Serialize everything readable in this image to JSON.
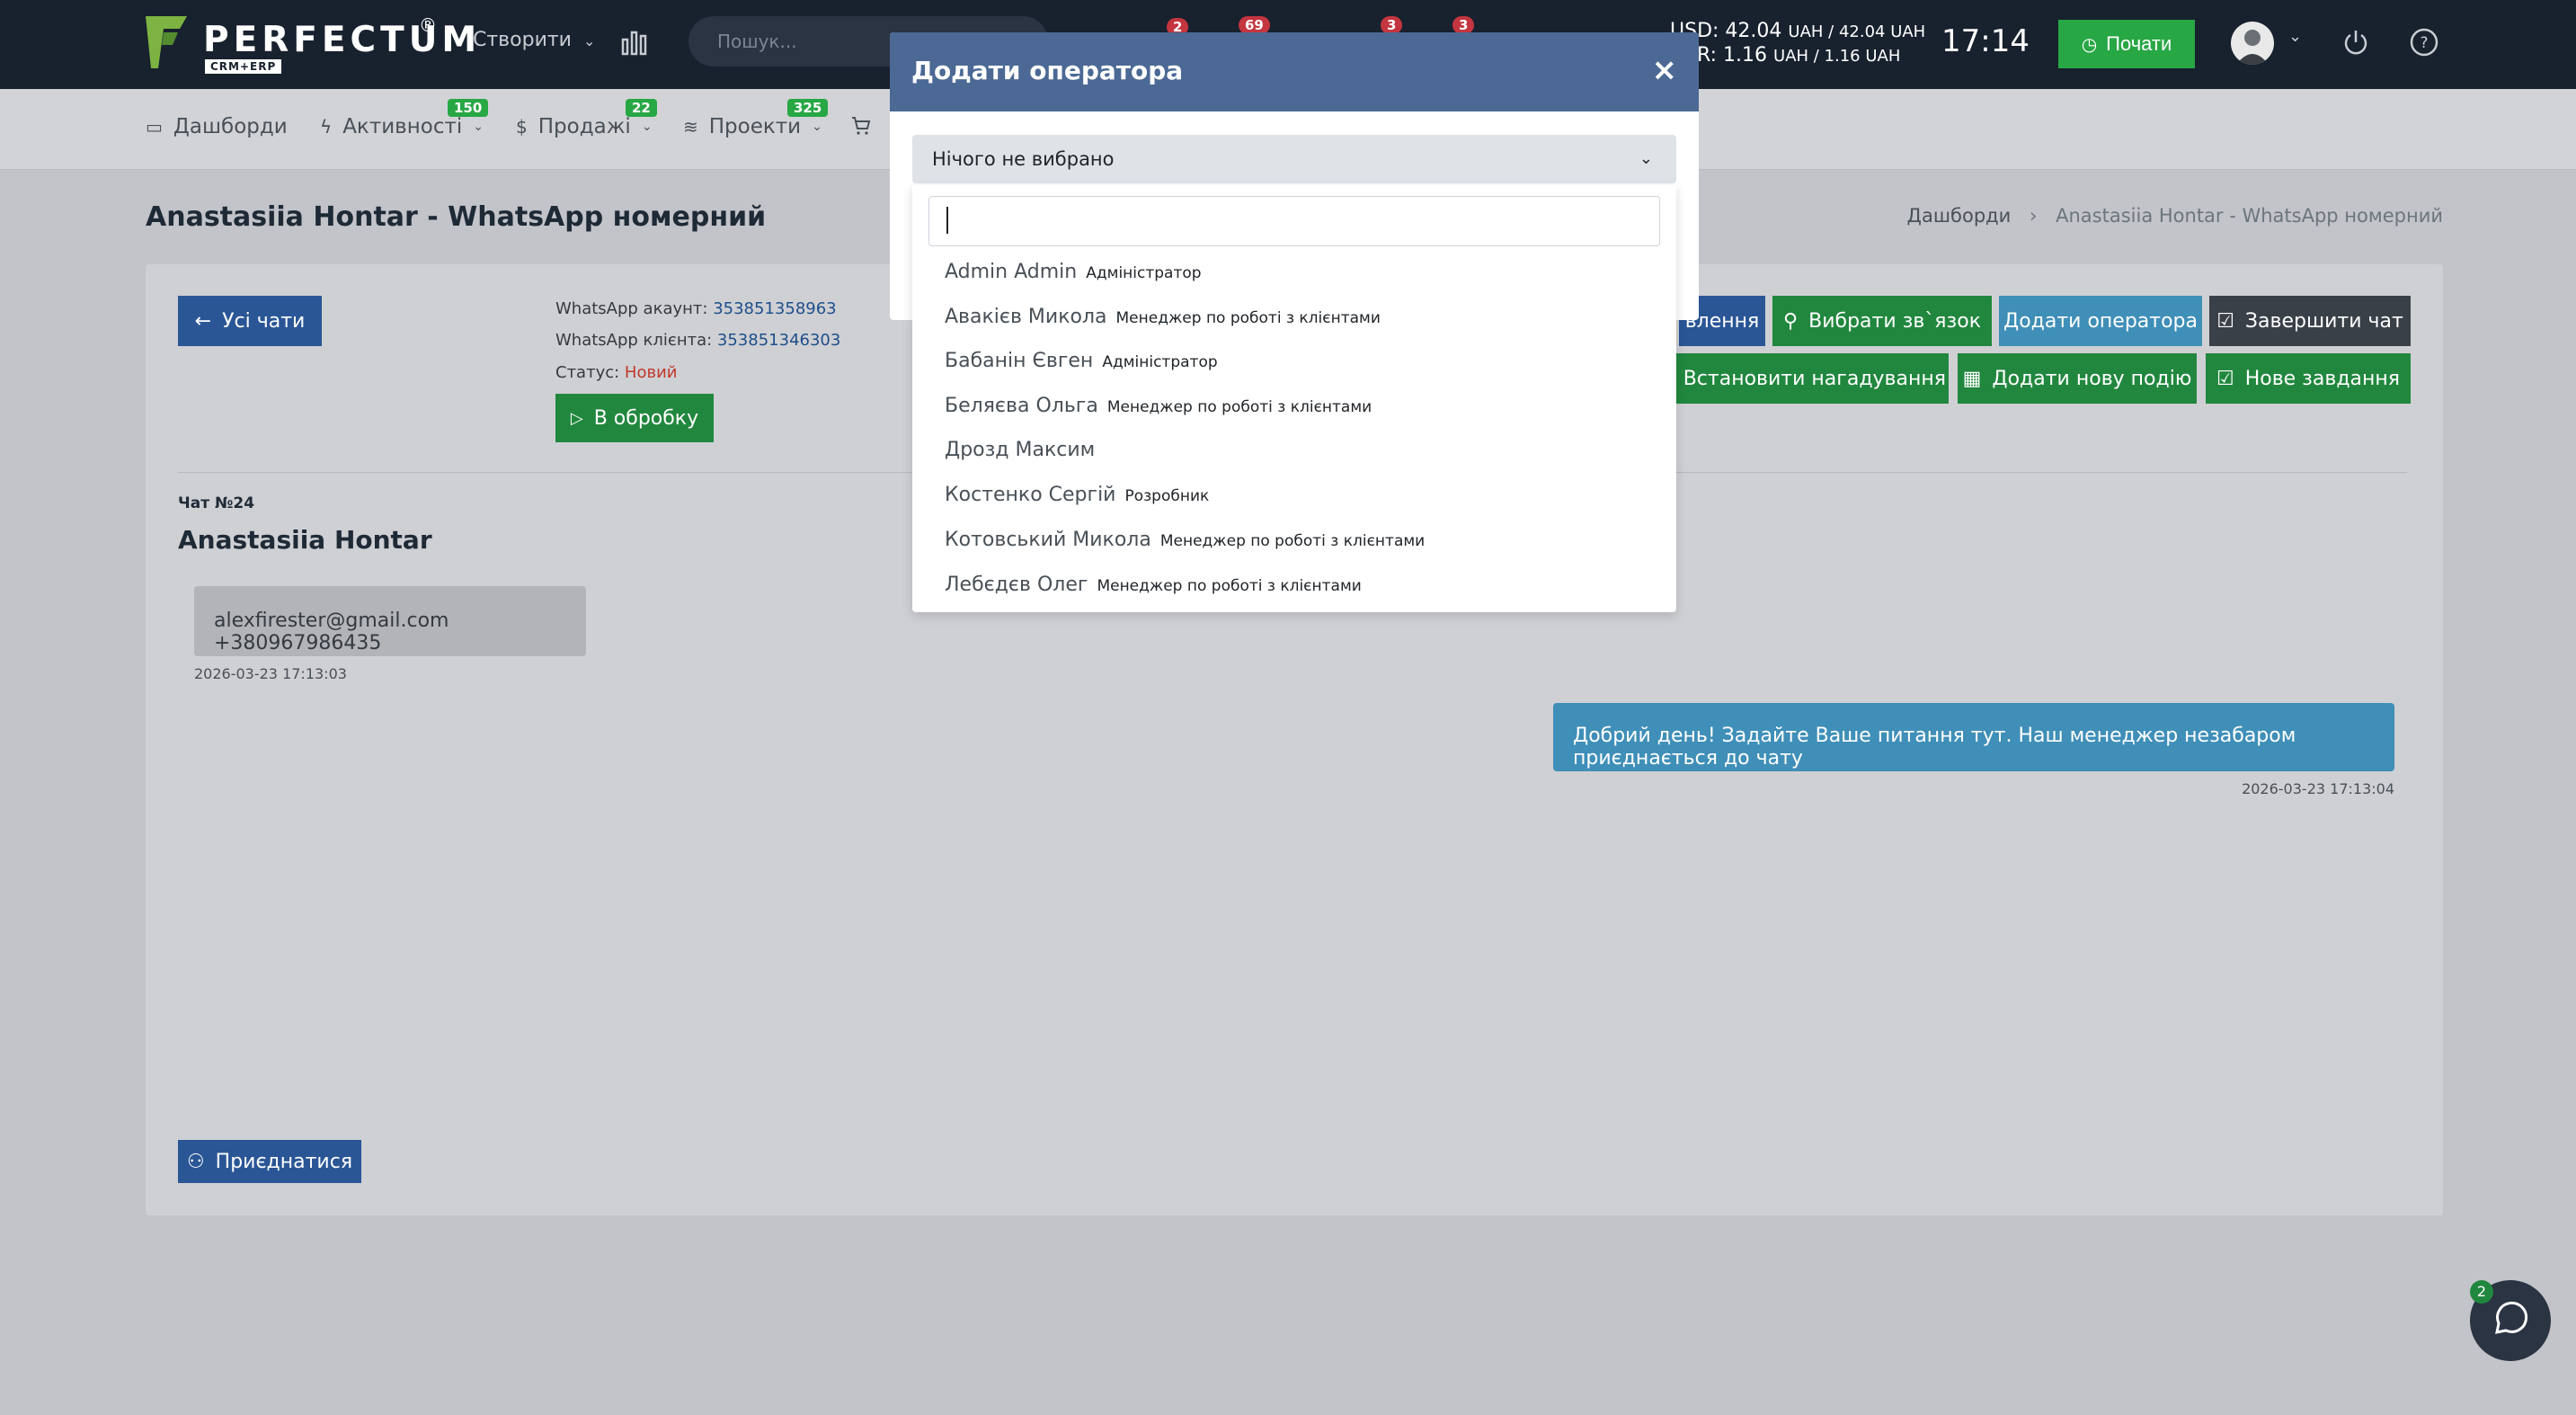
{
  "topbar": {
    "logo_text": "PERFECTUM",
    "logo_reg": "®",
    "logo_sub": "CRM+ERP",
    "create_label": "Створити",
    "search_placeholder": "Пошук...",
    "badges": [
      "2",
      "69",
      "3",
      "3"
    ],
    "rate_usd": "USD: 42.04",
    "rate_usd_unit": "UAH / 42.04 UAH",
    "rate_eur": "EUR: 1.16",
    "rate_eur_unit": "UAH / 1.16 UAH",
    "time": "17:14",
    "start_label": "Почати"
  },
  "nav": {
    "items": [
      {
        "label": "Дашборди"
      },
      {
        "label": "Активності",
        "badge": "150"
      },
      {
        "label": "Продажі",
        "badge": "22"
      },
      {
        "label": "Проекти",
        "badge": "325"
      }
    ]
  },
  "page": {
    "title": "Anastasiia Hontar - WhatsApp номерний",
    "breadcrumb_home": "Дашборди",
    "breadcrumb_current": "Anastasiia Hontar - WhatsApp номерний"
  },
  "chat": {
    "all_chats_label": "Усі чати",
    "account_label": "WhatsApp акаунт:",
    "account_value": "353851358963",
    "client_label": "WhatsApp клієнта:",
    "client_value": "353851346303",
    "status_label": "Статус:",
    "status_value": "Новий",
    "process_label": "В обробку",
    "actions": {
      "notify_label": "влення",
      "choose_link_label": "Вибрати зв`язок",
      "add_operator_label": "Додати оператора",
      "finish_chat_label": "Завершити чат",
      "reminder_label": "Встановити нагадування",
      "new_event_label": "Додати нову подію",
      "new_task_label": "Нове завдання"
    },
    "number_label": "Чат №24",
    "contact_name": "Anastasiia Hontar",
    "incoming_text": "alexfirester@gmail.com +380967986435",
    "incoming_time": "2026-03-23 17:13:03",
    "outgoing_text": "Добрий день! Задайте Ваше питання тут. Наш менеджер незабаром приєднається до чату",
    "outgoing_time": "2026-03-23 17:13:04",
    "join_label": "Приєднатися",
    "fab_badge": "2"
  },
  "modal": {
    "title": "Додати оператора",
    "close": "×",
    "select_value": "Нічого не вибрано",
    "search_value": "",
    "options": [
      {
        "name": "Admin Admin",
        "role": "Адміністратор"
      },
      {
        "name": "Авакієв Микола",
        "role": "Менеджер по роботі з клієнтами"
      },
      {
        "name": "Бабанін Євген",
        "role": "Адміністратор"
      },
      {
        "name": "Беляєва Ольга",
        "role": "Менеджер по роботі з клієнтами"
      },
      {
        "name": "Дрозд Максим",
        "role": ""
      },
      {
        "name": "Костенко Сергій",
        "role": "Розробник"
      },
      {
        "name": "Котовський Микола",
        "role": "Менеджер по роботі з клієнтами"
      },
      {
        "name": "Лебєдєв Олег",
        "role": "Менеджер по роботі з клієнтами"
      }
    ]
  }
}
